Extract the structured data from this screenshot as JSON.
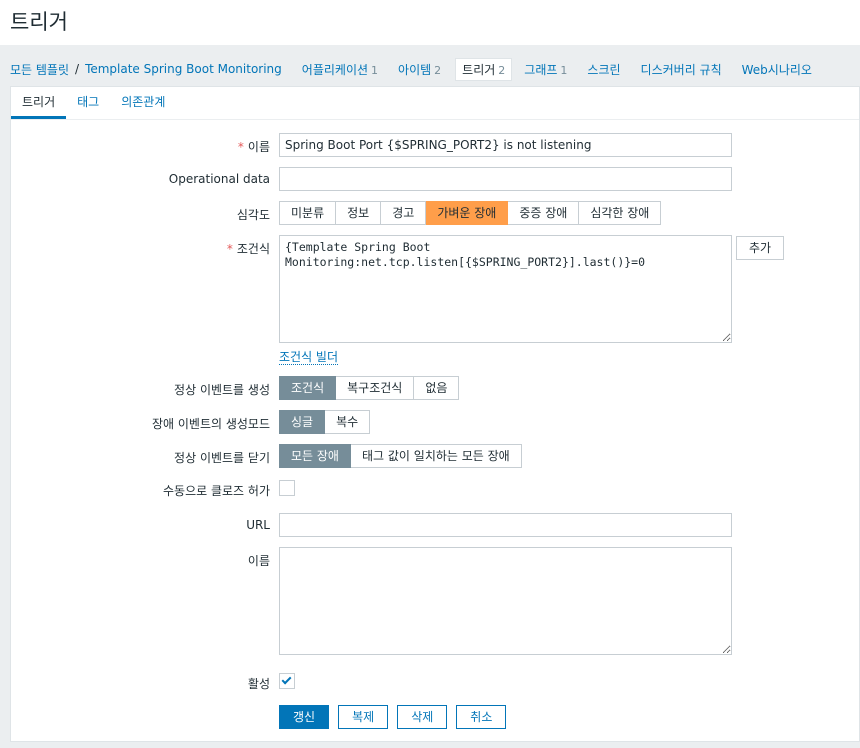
{
  "page": {
    "title": "트리거"
  },
  "nav": {
    "all_templates": "모든 템플릿",
    "separator": "/",
    "template_name": "Template Spring Boot Monitoring",
    "items": [
      {
        "label": "어플리케이션",
        "count": "1"
      },
      {
        "label": "아이템",
        "count": "2"
      },
      {
        "label": "트리거",
        "count": "2"
      },
      {
        "label": "그래프",
        "count": "1"
      },
      {
        "label": "스크린",
        "count": ""
      },
      {
        "label": "디스커버리 규칙",
        "count": ""
      },
      {
        "label": "Web시나리오",
        "count": ""
      }
    ]
  },
  "tabs": [
    "트리거",
    "태그",
    "의존관계"
  ],
  "form": {
    "required_mark": "*",
    "name_label": "이름",
    "name_value": "Spring Boot Port {$SPRING_PORT2} is not listening",
    "opdata_label": "Operational data",
    "opdata_value": "",
    "severity_label": "심각도",
    "severity_options": [
      "미분류",
      "정보",
      "경고",
      "가벼운 장애",
      "중증 장애",
      "심각한 장애"
    ],
    "severity_selected": "가벼운 장애",
    "expression_label": "조건식",
    "expression_value": "{Template Spring Boot\nMonitoring:net.tcp.listen[{$SPRING_PORT2}].last()}=0",
    "add_button": "추가",
    "builder_link": "조건식 빌더",
    "ok_event_label": "정상 이벤트를 생성",
    "ok_event_options": [
      "조건식",
      "복구조건식",
      "없음"
    ],
    "ok_event_selected": "조건식",
    "mode_label": "장애 이벤트의 생성모드",
    "mode_options": [
      "싱글",
      "복수"
    ],
    "mode_selected": "싱글",
    "close_label": "정상 이벤트를 닫기",
    "close_options": [
      "모든 장애",
      "태그 값이 일치하는 모든 장애"
    ],
    "close_selected": "모든 장애",
    "manual_close_label": "수동으로 클로즈 허가",
    "manual_close_checked": false,
    "url_label": "URL",
    "url_value": "",
    "description_label": "이름",
    "description_value": "",
    "enabled_label": "활성",
    "enabled_checked": true
  },
  "actions": {
    "update": "갱신",
    "clone": "복제",
    "delete": "삭제",
    "cancel": "취소"
  }
}
